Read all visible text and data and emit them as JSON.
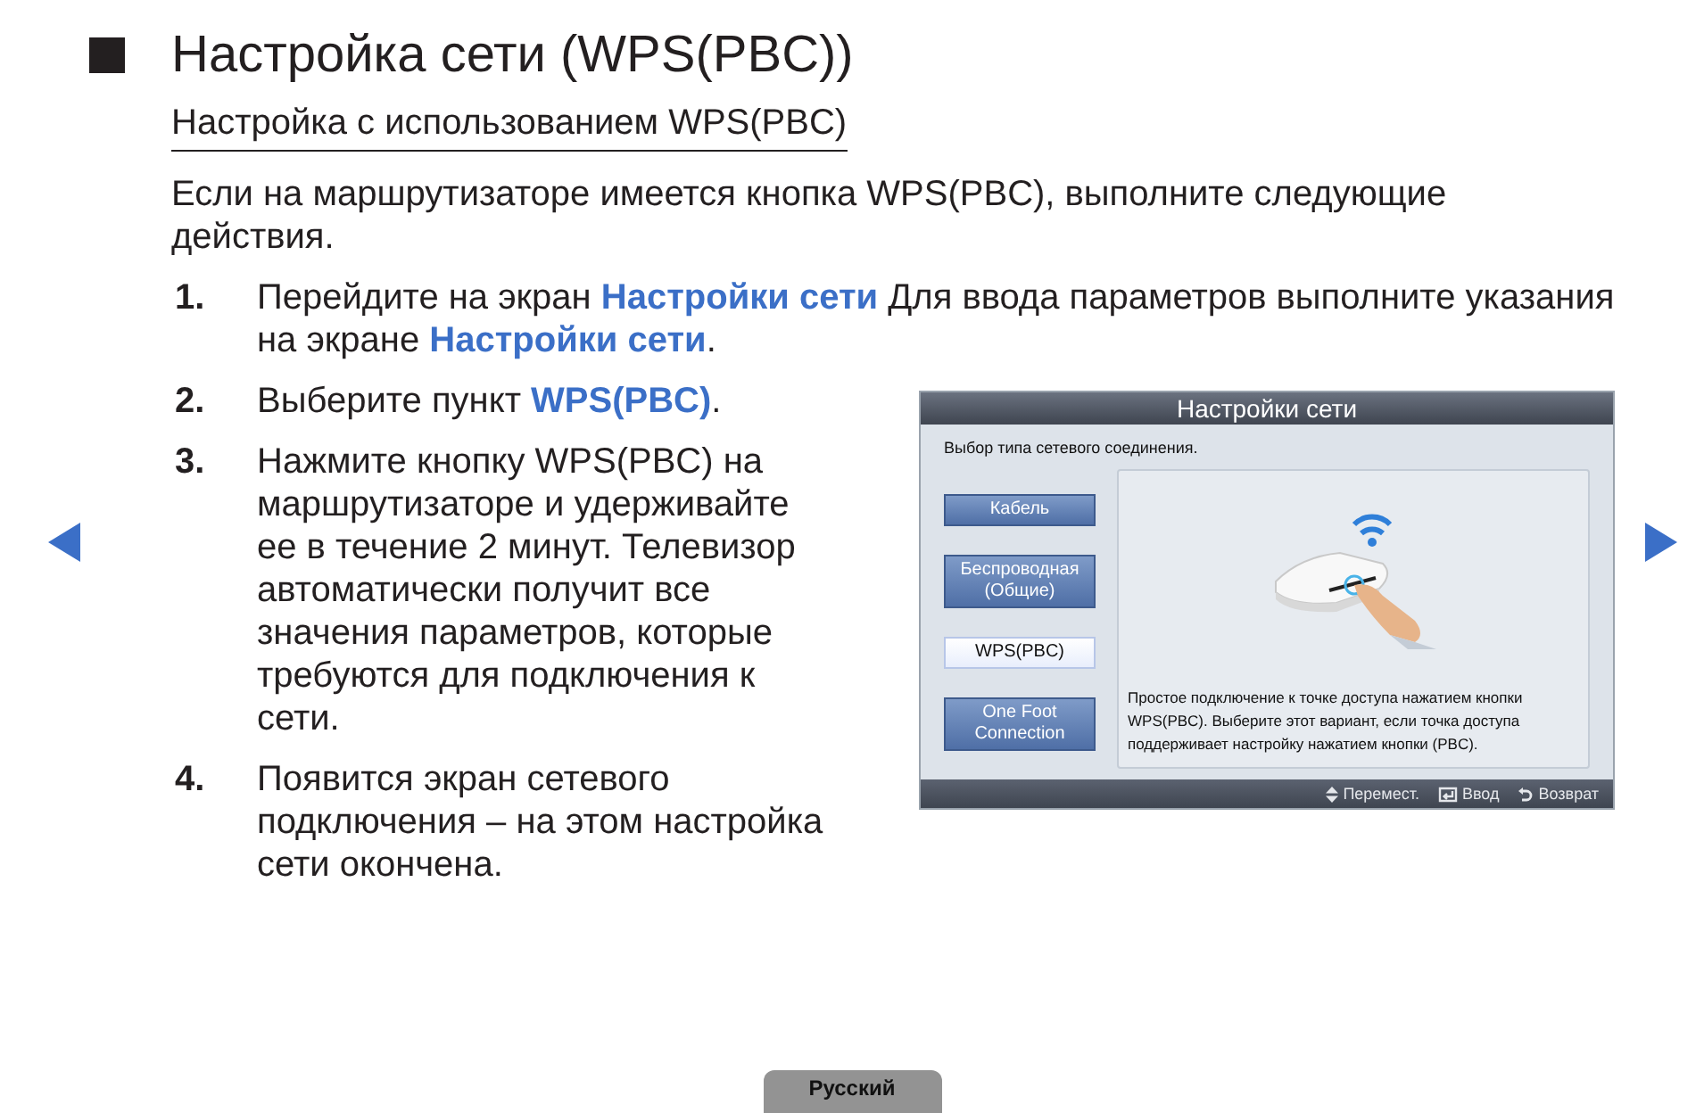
{
  "title": "Настройка сети (WPS(PBC))",
  "subtitle": "Настройка с использованием WPS(PBC)",
  "intro": "Если на маршрутизаторе имеется кнопка WPS(PBC), выполните следующие действия.",
  "steps": [
    {
      "number": "1.",
      "segments": [
        {
          "kind": "plain",
          "text": "Перейдите на экран "
        },
        {
          "kind": "link",
          "text": "Настройки сети"
        },
        {
          "kind": "plain",
          "text": " Для ввода параметров выполните указания на экране "
        },
        {
          "kind": "link",
          "text": "Настройки сети"
        },
        {
          "kind": "plain",
          "text": "."
        }
      ]
    },
    {
      "number": "2.",
      "segments": [
        {
          "kind": "plain",
          "text": "Выберите пункт "
        },
        {
          "kind": "link",
          "text": "WPS(PBC)"
        },
        {
          "kind": "plain",
          "text": "."
        }
      ]
    },
    {
      "number": "3.",
      "segments": [
        {
          "kind": "plain",
          "text": "Нажмите кнопку WPS(PBC) на маршрутизаторе и удерживайте ее в течение 2 минут. Телевизор автоматически получит все значения параметров, которые требуются для подключения к сети."
        }
      ]
    },
    {
      "number": "4.",
      "segments": [
        {
          "kind": "plain",
          "text": "Появится экран сетевого подключения – на этом настройка сети окончена."
        }
      ]
    }
  ],
  "screen": {
    "title": "Настройки сети",
    "prompt": "Выбор типа сетевого соединения.",
    "options": [
      {
        "label": "Кабель",
        "selected": false
      },
      {
        "label": "Беспроводная (Общие)",
        "selected": false
      },
      {
        "label": "WPS(PBC)",
        "selected": true
      },
      {
        "label": "One Foot Connection",
        "selected": false
      }
    ],
    "description": "Простое подключение к точке доступа нажатием кнопки WPS(PBC). Выберите этот вариант, если точка доступа поддерживает настройку нажатием кнопки (PBC).",
    "hints": [
      {
        "kind": "move",
        "label": "Перемест."
      },
      {
        "kind": "enter",
        "label": "Ввод"
      },
      {
        "kind": "return",
        "label": "Возврат"
      }
    ]
  },
  "language": "Русский"
}
